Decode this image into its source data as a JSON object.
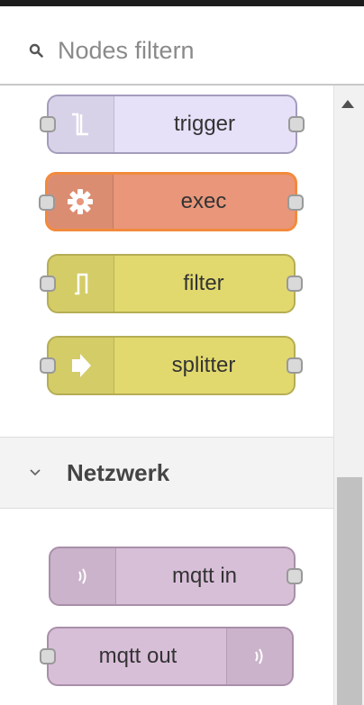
{
  "filter": {
    "placeholder": "Nodes filtern",
    "icon": "search-icon"
  },
  "palette": {
    "function_nodes": [
      {
        "label": "trigger",
        "icon": "trigger-icon",
        "color": "#e6e0f8"
      },
      {
        "label": "exec",
        "icon": "gear-icon",
        "color": "#e9967a",
        "selected": true
      },
      {
        "label": "filter",
        "icon": "filter-icon",
        "color": "#e2d96e"
      },
      {
        "label": "splitter",
        "icon": "arrow-right-icon",
        "color": "#e2d96e"
      }
    ],
    "category": {
      "title": "Netzwerk",
      "expanded": true,
      "nodes": [
        {
          "label": "mqtt in",
          "icon": "bridge-icon",
          "color": "#d8bfd8"
        },
        {
          "label": "mqtt out",
          "icon": "bridge-icon",
          "color": "#d8bfd8"
        }
      ]
    }
  },
  "colors": {
    "selected_border": "#f28a3c",
    "accent_border": "#999999"
  }
}
